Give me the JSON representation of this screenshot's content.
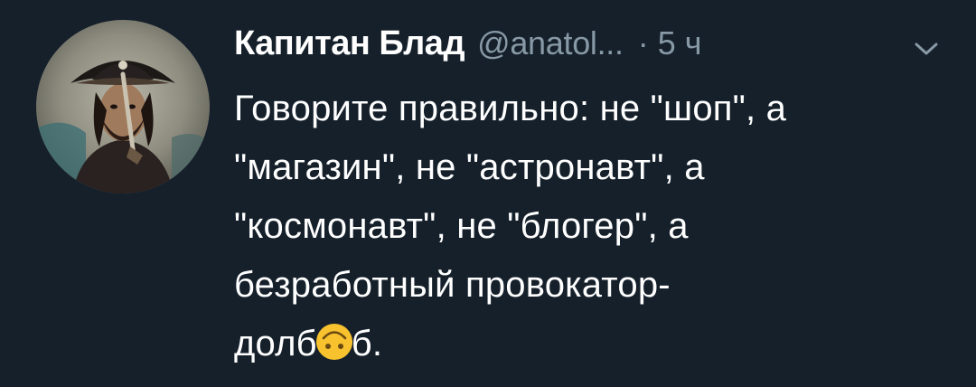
{
  "author": {
    "display_name": "Капитан Блад",
    "handle": "@anatol...",
    "separator": "·",
    "time": "5 ч"
  },
  "tweet": {
    "lines": [
      "Говорите правильно: не \"шоп\", а",
      "\"магазин\", не \"астронавт\", а",
      "\"космонавт\", не \"блогер\", а",
      "безработный провокатор-"
    ],
    "last_line_start": "долб",
    "last_line_end": "б."
  },
  "icons": {
    "avatar": "pirate-captain-avatar",
    "menu": "chevron-down-icon",
    "emoji": "upside-down-face-emoji"
  },
  "colors": {
    "background": "#15202b",
    "text": "#ffffff",
    "secondary": "#8899a6"
  }
}
